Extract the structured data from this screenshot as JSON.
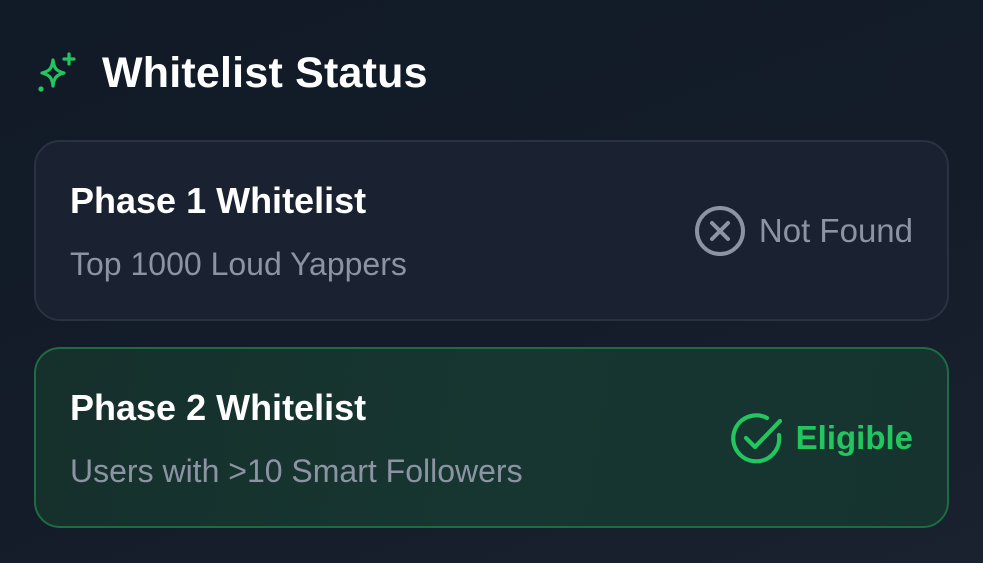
{
  "header": {
    "icon": "sparkles-icon",
    "title": "Whitelist Status",
    "accent_color": "#22c55e"
  },
  "phases": [
    {
      "title": "Phase 1 Whitelist",
      "subtitle": "Top 1000 Loud Yappers",
      "status": "Not Found",
      "status_icon": "x-circle-icon",
      "status_color": "#8c94a3"
    },
    {
      "title": "Phase 2 Whitelist",
      "subtitle": "Users with >10 Smart Followers",
      "status": "Eligible",
      "status_icon": "check-circle-icon",
      "status_color": "#22c55e"
    }
  ]
}
